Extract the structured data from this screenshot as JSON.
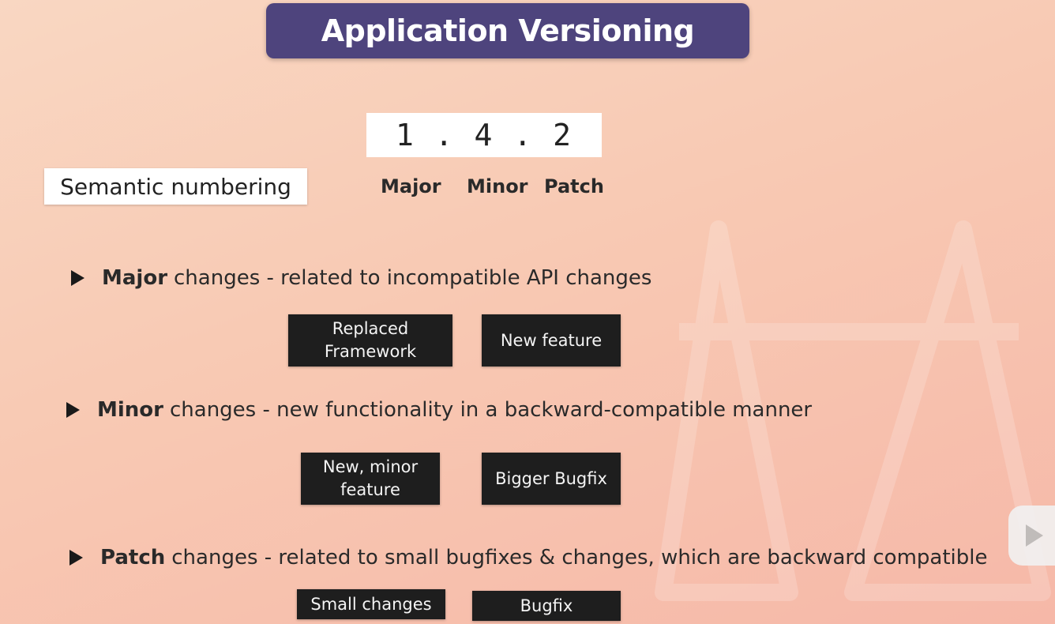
{
  "title": "Application Versioning",
  "version": {
    "display": "1 . 4 . 2",
    "labels": {
      "major": "Major",
      "minor": "Minor",
      "patch": "Patch"
    }
  },
  "semantic_label": "Semantic numbering",
  "sections": {
    "major": {
      "keyword": "Major",
      "text": "changes - related to incompatible API changes",
      "chips": [
        "Replaced Framework",
        "New feature"
      ]
    },
    "minor": {
      "keyword": "Minor",
      "text": "changes - new functionality in a backward-compatible manner",
      "chips": [
        "New, minor feature",
        "Bigger Bugfix"
      ]
    },
    "patch": {
      "keyword": "Patch",
      "text": "changes - related to small bugfixes & changes, which are backward compatible",
      "chips": [
        "Small changes",
        "Bugfix"
      ]
    }
  },
  "icons": {
    "bullet": "play-triangle-icon",
    "overlay": "play-button-icon"
  },
  "colors": {
    "title_bg": "#4e447d",
    "chip_bg": "#1e1e1e",
    "background_top": "#f9d7c2",
    "background_bottom": "#f6b8a8"
  }
}
